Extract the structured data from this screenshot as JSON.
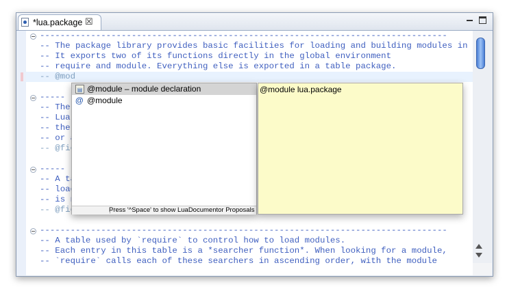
{
  "tab": {
    "title": "*lua.package",
    "icon": "lua-file-icon",
    "close_icon": "close-icon"
  },
  "window_controls": {
    "minimize_icon": "minimize-icon",
    "maximize_icon": "maximize-icon"
  },
  "editor": {
    "lines": [
      "--------------------------------------------------------------------------------",
      "-- The package library provides basic facilities for loading and building modules in Lua.",
      "-- It exports two of its functions directly in the global environment",
      "-- require and module. Everything else is exported in a table package.",
      "-- @mod",
      "-----",
      "-- The",
      "-- Lua",
      "-- the",
      "-- or a",
      "-- @fie",
      "",
      "-----",
      "-- A ta",
      "-- load",
      "-- is n",
      "-- @fie",
      "",
      "--------------------------------------------------------------------------------",
      "-- A table used by `require` to control how to load modules.",
      "-- Each entry in this table is a *searcher function*. When looking for a module,",
      "-- `require` calls each of these searchers in ascending order, with the module"
    ]
  },
  "completion": {
    "items": [
      {
        "label": "@module – module declaration",
        "icon": "template-icon",
        "selected": true
      },
      {
        "label": "@module",
        "icon": "at-icon",
        "selected": false
      }
    ],
    "status": "Press '^Space' to show LuaDocumentor Proposals"
  },
  "info": {
    "text": "@module lua.package"
  }
}
